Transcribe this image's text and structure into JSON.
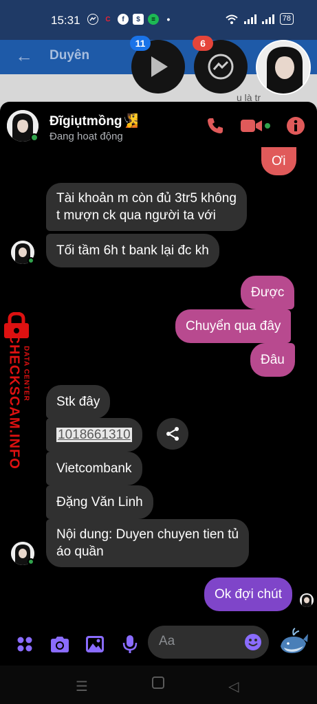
{
  "status_bar": {
    "time": "15:31",
    "battery": "78"
  },
  "background_app": {
    "title": "Duyên",
    "partial_text": "u là tr"
  },
  "chat_heads": {
    "badge_1": "11",
    "badge_2": "6"
  },
  "header": {
    "name": "Đĩgiụtmồng🧏",
    "status": "Đang hoạt động"
  },
  "messages": {
    "m0": "Ơi",
    "m1_line1": "Tài khoản m còn đủ 3tr5 không",
    "m1_line2": "t mượn ck qua người ta với",
    "m2": "Tối tầm 6h t bank lại đc kh",
    "m3": "Được",
    "m4": "Chuyển qua đây",
    "m5": "Đâu",
    "m6": "Stk đây",
    "m7": "1018661310",
    "m8": "Vietcombank",
    "m9": "Đặng Văn Linh",
    "m10_line1": "Nội dung: Duyen chuyen tien tủ",
    "m10_line2": "áo quần",
    "m11": "Ok đợi chút"
  },
  "watermark": {
    "line1": "DATA CENTER",
    "line2": "CHECKSCAM.INFO"
  },
  "composer": {
    "placeholder": "Aa"
  },
  "colors": {
    "accent": "#b84a8f",
    "purple": "#7f45c9",
    "icon": "#8a6cff",
    "red": "#e05a5a"
  }
}
